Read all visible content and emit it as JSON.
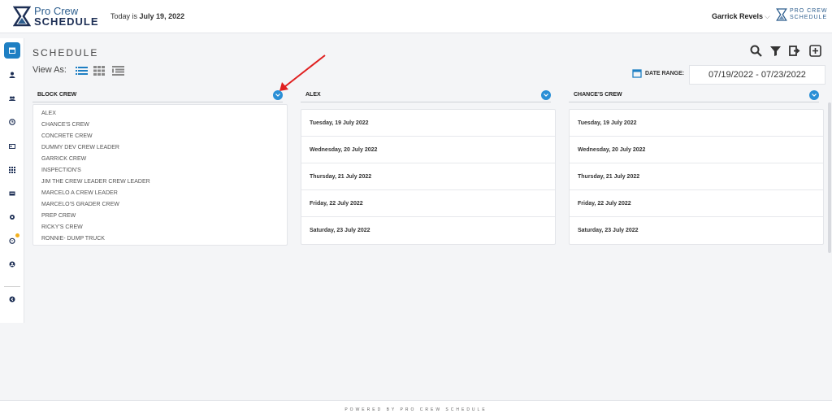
{
  "header": {
    "logo_line1": "Pro Crew",
    "logo_line2": "SCHEDULE",
    "today_prefix": "Today is",
    "today_date": "July 19, 2022",
    "user_name": "Garrick Revels",
    "user_caret": "⌵",
    "brand_line1": "PRO CREW",
    "brand_line2": "SCHEDULE"
  },
  "sidebar": {
    "items": [
      {
        "name": "calendar",
        "active": true
      },
      {
        "name": "user"
      },
      {
        "name": "users"
      },
      {
        "name": "clock"
      },
      {
        "name": "id-card"
      },
      {
        "name": "grid"
      },
      {
        "name": "truck"
      },
      {
        "name": "gear"
      },
      {
        "name": "notifications"
      },
      {
        "name": "account"
      },
      {
        "name": "collapse"
      }
    ]
  },
  "page": {
    "title": "SCHEDULE",
    "view_as_label": "View As:",
    "date_range_label": "DATE RANGE:",
    "date_range_value": "07/19/2022 - 07/23/2022"
  },
  "columns": [
    {
      "title": "BLOCK CREW",
      "crews": [
        "ALEX",
        "CHANCE'S CREW",
        "CONCRETE CREW",
        "DUMMY DEV CREW LEADER",
        "GARRICK CREW",
        "INSPECTION'S",
        "JIM THE CREW LEADER CREW LEADER",
        "MARCELO A CREW LEADER",
        "MARCELO'S GRADER CREW",
        "PREP CREW",
        "RICKY'S CREW",
        "RONNIE- DUMP TRUCK"
      ]
    },
    {
      "title": "ALEX",
      "days": [
        "Tuesday, 19 July 2022",
        "Wednesday, 20 July 2022",
        "Thursday, 21 July 2022",
        "Friday, 22 July 2022",
        "Saturday, 23 July 2022"
      ]
    },
    {
      "title": "CHANCE'S CREW",
      "days": [
        "Tuesday, 19 July 2022",
        "Wednesday, 20 July 2022",
        "Thursday, 21 July 2022",
        "Friday, 22 July 2022",
        "Saturday, 23 July 2022"
      ]
    }
  ],
  "footer": {
    "text": "POWERED BY PRO CREW SCHEDULE"
  },
  "colors": {
    "accent": "#1e7fc3",
    "chevron": "#2a8fd6",
    "annotation_arrow": "#e02020"
  }
}
